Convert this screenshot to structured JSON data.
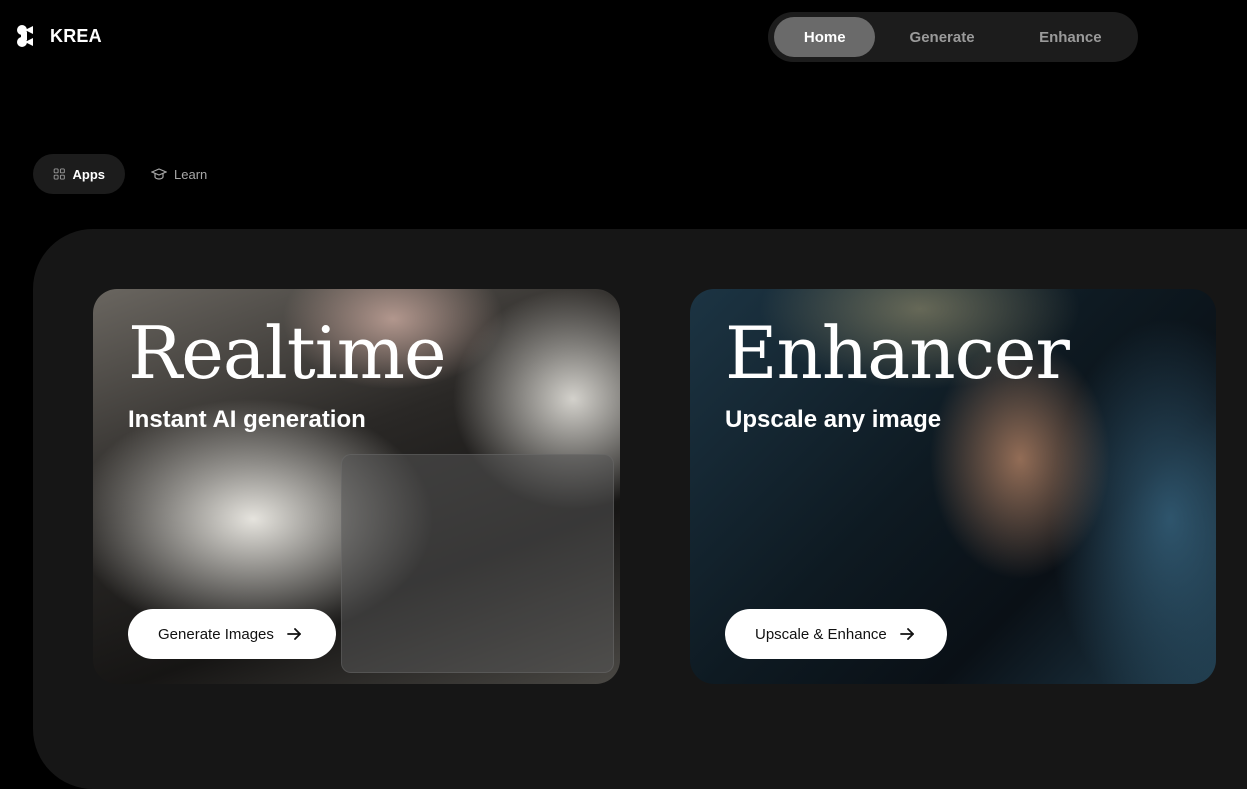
{
  "brand": {
    "name": "KREA",
    "logo_icon": "krea-logo-icon"
  },
  "top_nav": {
    "tabs": [
      {
        "label": "Home",
        "active": true
      },
      {
        "label": "Generate",
        "active": false
      },
      {
        "label": "Enhance",
        "active": false
      }
    ]
  },
  "sub_nav": {
    "items": [
      {
        "label": "Apps",
        "icon": "grid-icon",
        "active": true
      },
      {
        "label": "Learn",
        "icon": "graduation-cap-icon",
        "active": false
      }
    ]
  },
  "cards": [
    {
      "title": "Realtime",
      "subtitle": "Instant AI generation",
      "button_label": "Generate Images",
      "button_icon": "arrow-right-icon"
    },
    {
      "title": "Enhancer",
      "subtitle": "Upscale any image",
      "button_label": "Upscale & Enhance",
      "button_icon": "arrow-right-icon"
    }
  ],
  "colors": {
    "background": "#000000",
    "panel": "#161616",
    "active_tab": "#6a6a6a",
    "button": "#ffffff"
  }
}
